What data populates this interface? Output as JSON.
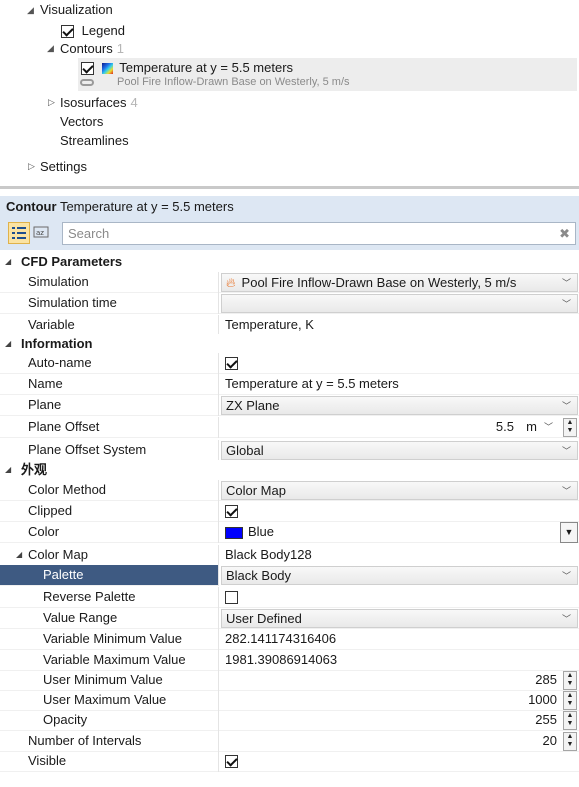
{
  "tree": {
    "visualization": "Visualization",
    "legend": "Legend",
    "contours": "Contours",
    "contours_count": "1",
    "contour_item": "Temperature at y = 5.5 meters",
    "contour_item_sub": "Pool Fire Inflow-Drawn Base on Westerly, 5 m/s",
    "isosurfaces": "Isosurfaces",
    "isosurfaces_count": "4",
    "vectors": "Vectors",
    "streamlines": "Streamlines",
    "settings": "Settings"
  },
  "panel": {
    "type": "Contour",
    "title": "Temperature at y = 5.5 meters",
    "search_placeholder": "Search"
  },
  "categories": {
    "cfd": "CFD Parameters",
    "info": "Information",
    "appearance": "外观"
  },
  "props": {
    "simulation": {
      "label": "Simulation",
      "value": "Pool Fire Inflow-Drawn Base on Westerly, 5 m/s"
    },
    "simulation_time": {
      "label": "Simulation time",
      "value": ""
    },
    "variable": {
      "label": "Variable",
      "value": "Temperature, K"
    },
    "auto_name": {
      "label": "Auto-name",
      "checked": true
    },
    "name": {
      "label": "Name",
      "value": "Temperature at y = 5.5 meters"
    },
    "plane": {
      "label": "Plane",
      "value": "ZX Plane"
    },
    "plane_offset": {
      "label": "Plane Offset",
      "value": "5.5",
      "unit": "m"
    },
    "plane_offset_system": {
      "label": "Plane Offset System",
      "value": "Global"
    },
    "color_method": {
      "label": "Color Method",
      "value": "Color Map"
    },
    "clipped": {
      "label": "Clipped",
      "checked": true
    },
    "color": {
      "label": "Color",
      "value": "Blue",
      "hex": "#0000ff"
    },
    "color_map": {
      "label": "Color Map",
      "value": "Black Body128"
    },
    "palette": {
      "label": "Palette",
      "value": "Black Body"
    },
    "reverse_palette": {
      "label": "Reverse Palette",
      "checked": false
    },
    "value_range": {
      "label": "Value Range",
      "value": "User Defined"
    },
    "var_min": {
      "label": "Variable Minimum Value",
      "value": "282.141174316406"
    },
    "var_max": {
      "label": "Variable Maximum Value",
      "value": "1981.39086914063"
    },
    "user_min": {
      "label": "User Minimum Value",
      "value": "285"
    },
    "user_max": {
      "label": "User Maximum Value",
      "value": "1000"
    },
    "opacity": {
      "label": "Opacity",
      "value": "255"
    },
    "intervals": {
      "label": "Number of Intervals",
      "value": "20"
    },
    "visible": {
      "label": "Visible",
      "checked": true
    }
  },
  "colors": {
    "header_bg": "#dde7f3",
    "selected_row": "#3e5a82",
    "swatch": "#0000ff"
  }
}
